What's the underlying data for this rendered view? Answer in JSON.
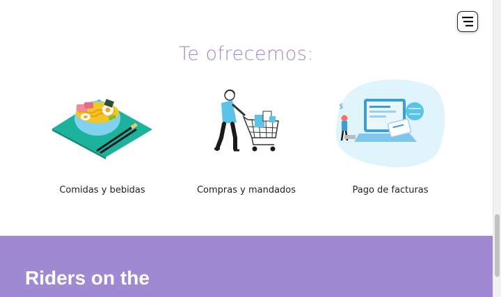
{
  "section": {
    "title": "Te ofrecemos:"
  },
  "services": [
    {
      "label": "Comidas y bebidas",
      "icon": "noodle-bowl-illustration"
    },
    {
      "label": "Compras y mandados",
      "icon": "shopping-cart-illustration"
    },
    {
      "label": "Pago de facturas",
      "icon": "bill-payment-illustration"
    }
  ],
  "band": {
    "heading": "Riders on the"
  },
  "menu": {
    "icon": "hamburger-menu-icon"
  },
  "colors": {
    "accent": "#a385d4",
    "band": "#a089d3",
    "teal": "#1bb39b",
    "lightblue": "#7fd3f0"
  }
}
